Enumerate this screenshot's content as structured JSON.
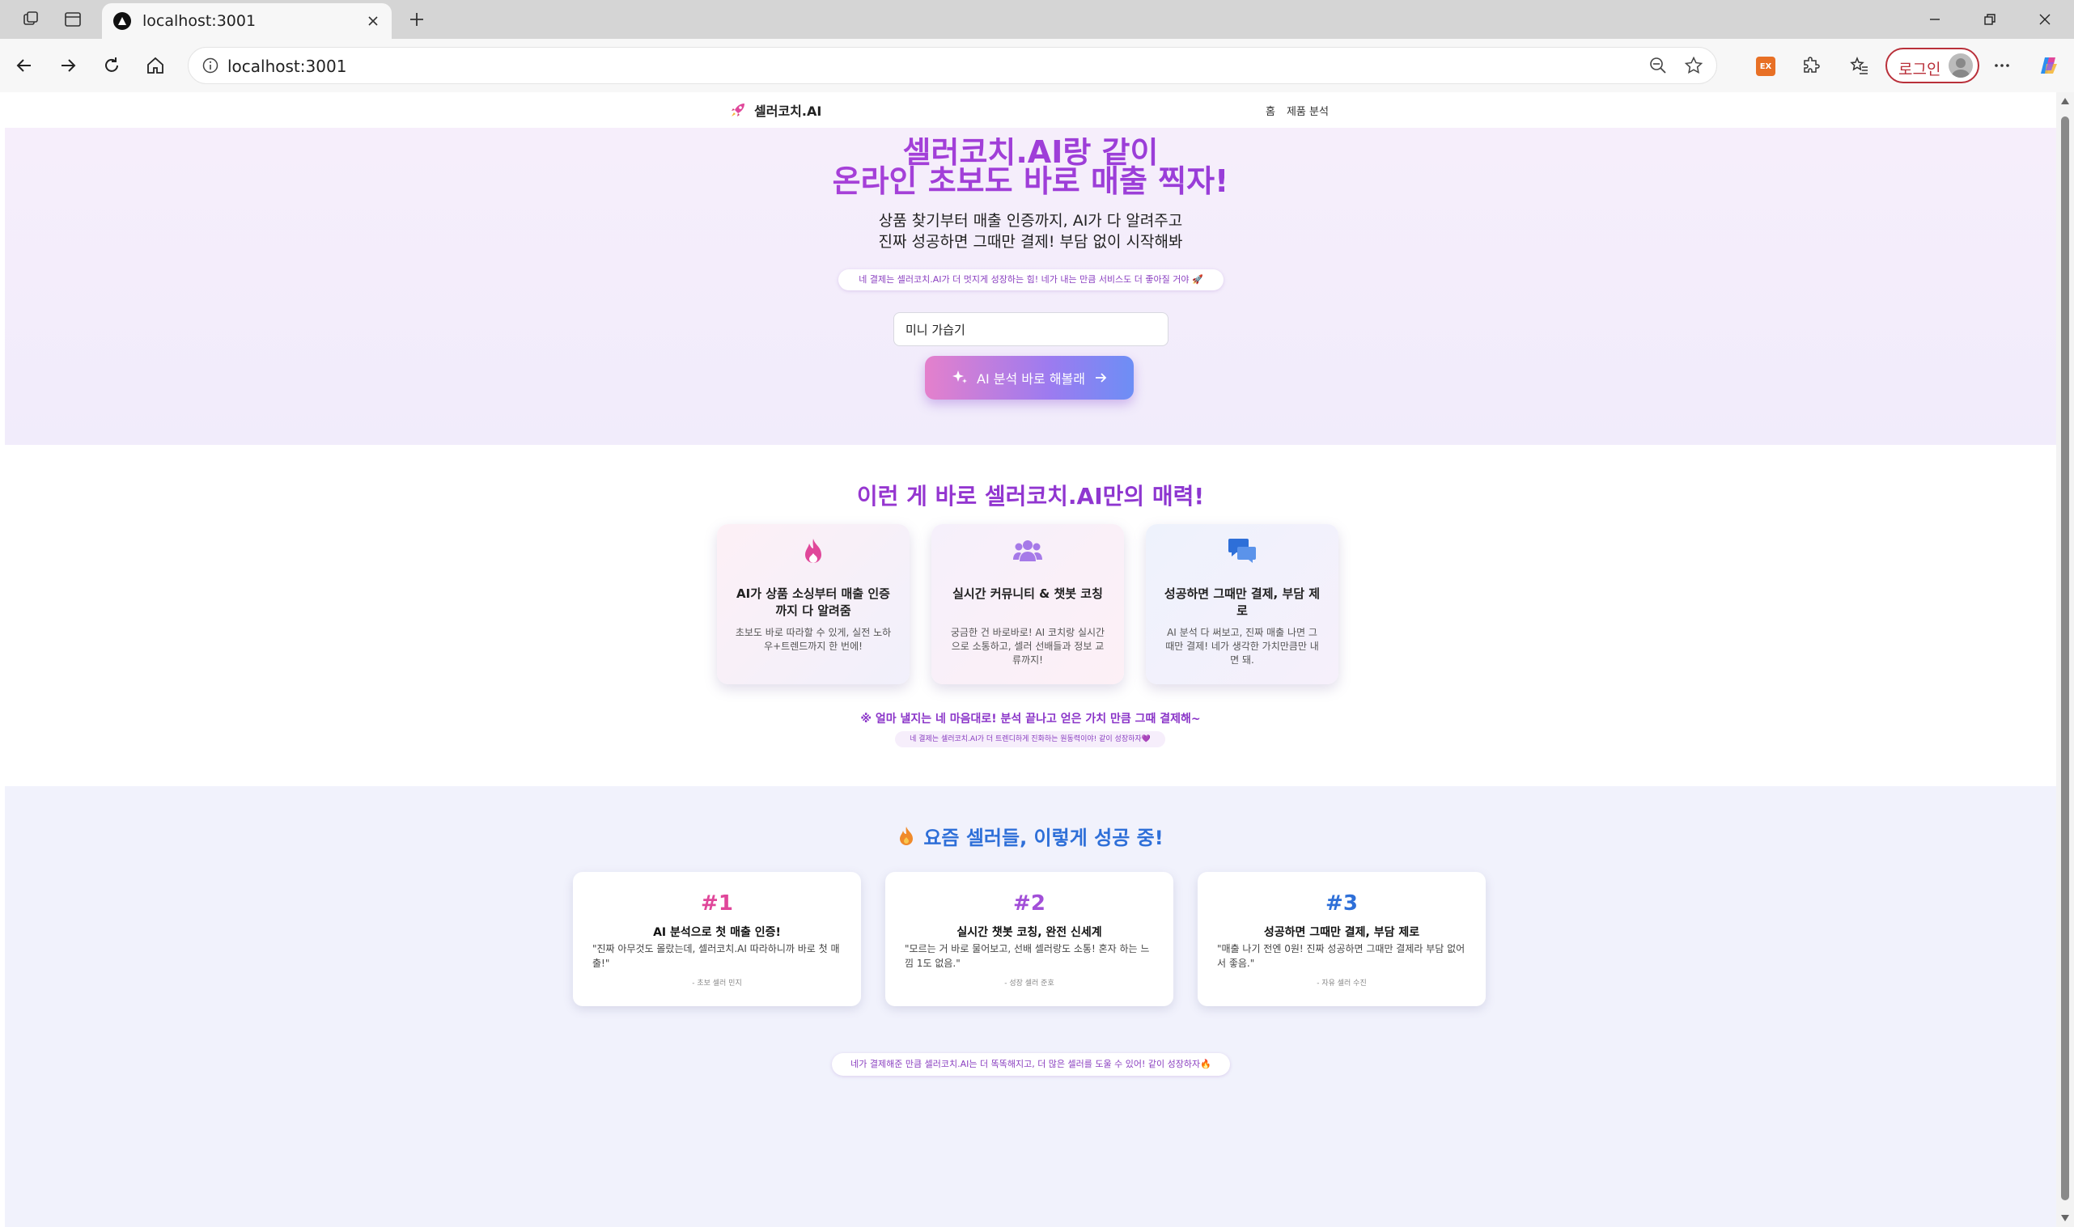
{
  "browser": {
    "tab_title": "localhost:3001",
    "url": "localhost:3001",
    "login_label": "로그인",
    "extension_label": "EX"
  },
  "site": {
    "logo_name": "셀러코치.AI",
    "menu": [
      "홈",
      "제품 분석"
    ]
  },
  "hero": {
    "title_line1": "셀러코치.AI랑 같이",
    "title_line2": "온라인 초보도 바로 매출 찍자!",
    "subtitle_line1": "상품 찾기부터 매출 인증까지, AI가 다 알려주고",
    "subtitle_line2": "진짜 성공하면 그때만 결제! 부담 없이 시작해봐",
    "pill": "네 결제는 셀러코치.AI가 더 멋지게 성장하는 힘! 네가 내는 만큼 서비스도 더 좋아질 거야 🚀",
    "input_value": "미니 가습기",
    "button_label": "AI 분석 바로 해볼래"
  },
  "features": {
    "heading": "이런 게 바로 셀러코치.AI만의 매력!",
    "cards": [
      {
        "icon": "fire-icon",
        "title": "AI가 상품 소싱부터 매출 인증까지 다 알려줌",
        "desc": "초보도 바로 따라할 수 있게, 실전 노하우+트렌드까지 한 번에!"
      },
      {
        "icon": "users-icon",
        "title": "실시간 커뮤니티 & 챗봇 코칭",
        "desc": "궁금한 건 바로바로! AI 코치랑 실시간으로 소통하고, 셀러 선배들과 정보 교류까지!"
      },
      {
        "icon": "chat-icon",
        "title": "성공하면 그때만 결제, 부담 제로",
        "desc": "AI 분석 다 써보고, 진짜 매출 나면 그때만 결제! 네가 생각한 가치만큼만 내면 돼."
      }
    ],
    "note": "※ 얼마 낼지는 네 마음대로! 분석 끝나고 얻은 가치 만큼 그때 결제해~",
    "subnote": "네 결제는 셀러코치.AI가 더 트렌디하게 진화하는 원동력이야! 같이 성장하자💜"
  },
  "testimonials": {
    "heading": "요즘 셀러들, 이렇게 성공 중!",
    "cards": [
      {
        "rank": "#1",
        "title": "AI 분석으로 첫 매출 인증!",
        "quote": "\"진짜 아무것도 몰랐는데, 셀러코치.AI 따라하니까 바로 첫 매출!\"",
        "author": "- 초보 셀러 민지"
      },
      {
        "rank": "#2",
        "title": "실시간 챗봇 코칭, 완전 신세계",
        "quote": "\"모르는 거 바로 물어보고, 선배 셀러랑도 소통! 혼자 하는 느낌 1도 없음.\"",
        "author": "- 성장 셀러 준호"
      },
      {
        "rank": "#3",
        "title": "성공하면 그때만 결제, 부담 제로",
        "quote": "\"매출 나기 전엔 0원! 진짜 성공하면 그때만 결제라 부담 없어서 좋음.\"",
        "author": "- 자유 셀러 수진"
      }
    ],
    "bottom_note": "네가 결제해준 만큼 셀러코치.AI는 더 똑똑해지고, 더 많은 셀러를 도울 수 있어! 같이 성장하자🔥"
  },
  "colors": {
    "accent_purple": "#8a34c8",
    "accent_pink": "#e0479a",
    "accent_blue": "#2e6fd8",
    "login_red": "#b9303a"
  }
}
